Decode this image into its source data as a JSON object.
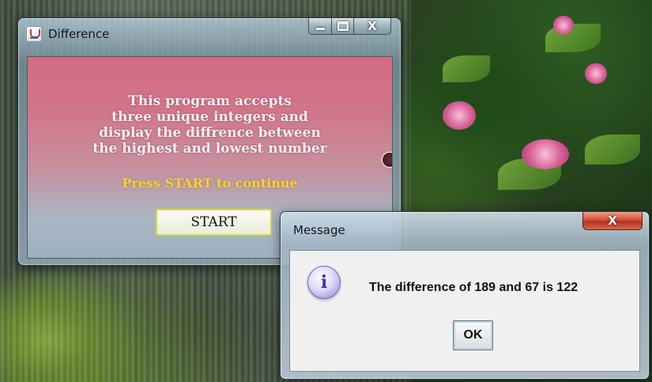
{
  "window": {
    "title": "Difference",
    "close_glyph": "X",
    "description_lines": [
      "This program accepts",
      "three unique integers and",
      "display the diffrence between",
      "the highest and lowest number"
    ],
    "prompt": "Press START to continue",
    "start_label": "START",
    "icon": "java-icon"
  },
  "dialog": {
    "title": "Message",
    "close_glyph": "X",
    "message": "The difference of 189 and 67 is 122",
    "ok_label": "OK",
    "icon": "info-icon"
  },
  "colors": {
    "prompt": "#f6cf3a",
    "client_top": "#d36c85",
    "client_bottom": "#9fb1c1",
    "close_red": "#d5503a"
  }
}
